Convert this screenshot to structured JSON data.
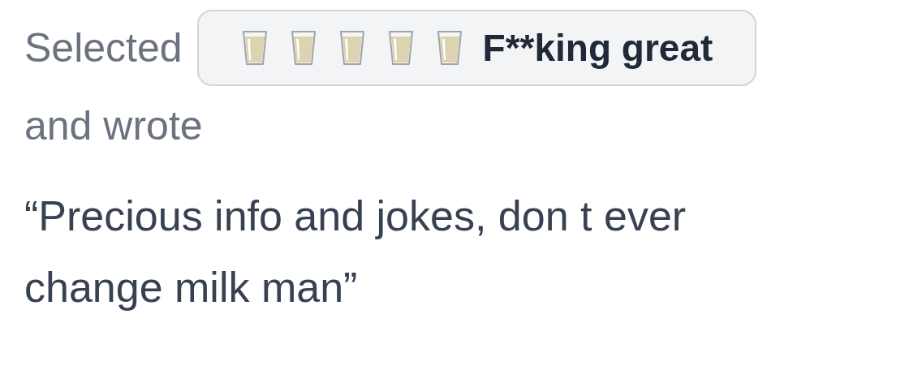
{
  "review": {
    "prefix": "Selected",
    "rating": {
      "stars": 5,
      "label": "F**king great"
    },
    "suffix": "and wrote",
    "comment": "“Precious info and jokes, don t ever change milk man”"
  }
}
